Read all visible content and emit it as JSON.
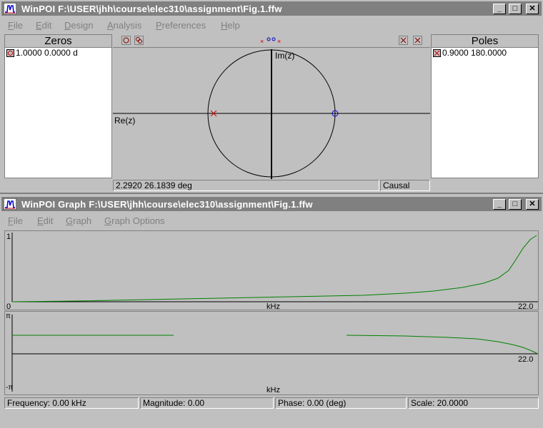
{
  "pole_window": {
    "title": "WinPOI  F:\\USER\\jhh\\course\\elec310\\assignment\\Fig.1.ffw",
    "menu": [
      "File",
      "Edit",
      "Design",
      "Analysis",
      "Preferences",
      "Help"
    ],
    "zeros": {
      "header": "Zeros",
      "items": [
        "1.0000 0.0000 d"
      ]
    },
    "poles": {
      "header": "Poles",
      "items": [
        "0.9000 180.0000"
      ]
    },
    "plane": {
      "im_label": "Im(z)",
      "re_label": "Re(z)"
    },
    "status": {
      "coords": "2.2920 26.1839 deg",
      "mode": "Causal"
    }
  },
  "graph_window": {
    "title": "WinPOI Graph  F:\\USER\\jhh\\course\\elec310\\assignment\\Fig.1.ffw",
    "menu": [
      "File",
      "Edit",
      "Graph",
      "Graph Options"
    ],
    "magnitude_plot": {
      "y_max_label": "1",
      "x_min_label": "0",
      "x_unit": "kHz",
      "x_max_label": "22.0"
    },
    "phase_plot": {
      "y_top_label": "π",
      "y_bottom_label": "-π",
      "x_unit": "kHz",
      "x_max_label": "22.0"
    },
    "status": {
      "frequency": "Frequency: 0.00 kHz",
      "magnitude": "Magnitude: 0.00",
      "phase": "Phase: 0.00 (deg)",
      "scale": "Scale: 20.0000"
    }
  },
  "colors": {
    "title_bar": "#808080",
    "zero": "#0000cc",
    "pole": "#cc0000",
    "curve": "#008000"
  }
}
